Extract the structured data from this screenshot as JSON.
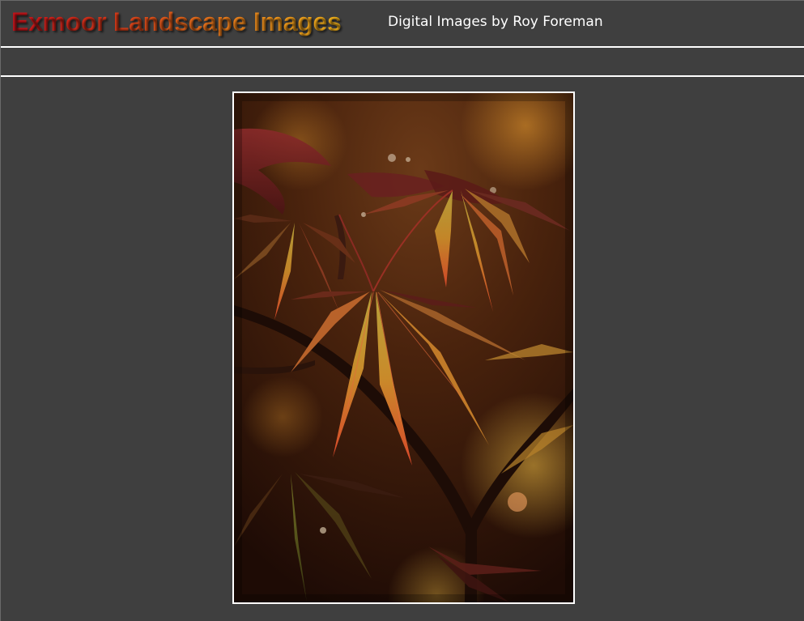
{
  "header": {
    "title": "Exmoor Landscape Images",
    "subtitle": "Digital Images by Roy Foreman"
  },
  "photo": {
    "subject": "autumn maple leaves photograph"
  },
  "colors": {
    "background": "#3f3f3f",
    "divider": "#ffffff",
    "title_gradient_start": "#c8121b",
    "title_gradient_end": "#f2b41c",
    "subtitle_text": "#ffffff",
    "frame_border": "#ffffff"
  }
}
